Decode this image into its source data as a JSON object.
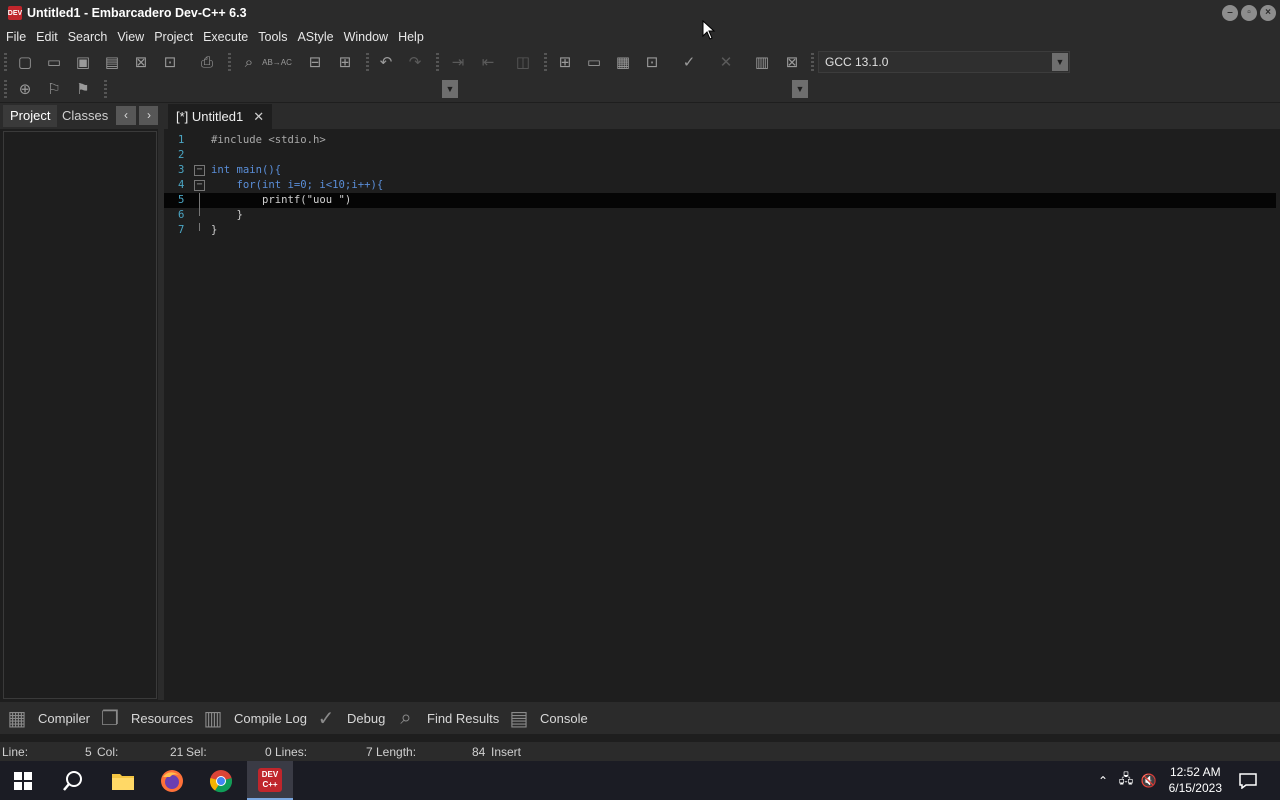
{
  "window": {
    "title": "Untitled1 - Embarcadero Dev-C++ 6.3",
    "app_icon_text": "DEV"
  },
  "menu": [
    "File",
    "Edit",
    "Search",
    "View",
    "Project",
    "Execute",
    "Tools",
    "AStyle",
    "Window",
    "Help"
  ],
  "toolbar": {
    "compiler_select": "GCC 13.1.0",
    "abc_label": "AB→AC"
  },
  "left_panel": {
    "tabs": [
      "Project",
      "Classes"
    ]
  },
  "editor": {
    "tab_label": "[*] Untitled1",
    "current_line": 5,
    "lines": [
      {
        "n": "1",
        "text": "#include <stdio.h>"
      },
      {
        "n": "2",
        "text": ""
      },
      {
        "n": "3",
        "text": "int main(){"
      },
      {
        "n": "4",
        "text": "    for(int i=0; i<10;i++){"
      },
      {
        "n": "5",
        "text": "        printf(\"uou \")"
      },
      {
        "n": "6",
        "text": "    }"
      },
      {
        "n": "7",
        "text": "}"
      }
    ]
  },
  "bottom_tabs": [
    "Compiler",
    "Resources",
    "Compile Log",
    "Debug",
    "Find Results",
    "Console"
  ],
  "status": {
    "line_label": "Line:",
    "line_value": "5",
    "col_label": "Col:",
    "col_value": "21",
    "sel_label": "Sel:",
    "sel_value": "0",
    "lines_label": "Lines:",
    "lines_value": "7",
    "length_label": "Length:",
    "length_value": "84",
    "mode": "Insert"
  },
  "taskbar": {
    "time": "12:52 AM",
    "date": "6/15/2023",
    "devcpp_label": "DEV C++"
  },
  "colors": {
    "accent": "#c0262c",
    "line_numbers": "#4ba6c4",
    "keyword": "#5a8ed8"
  }
}
